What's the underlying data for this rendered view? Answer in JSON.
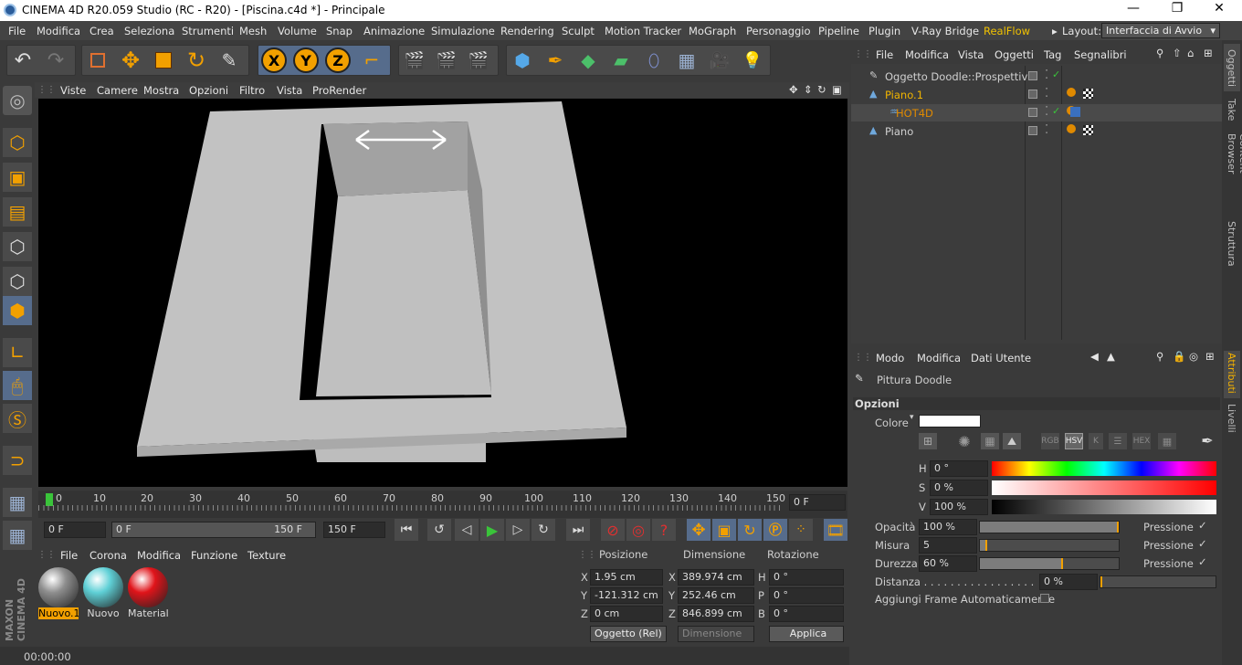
{
  "window": {
    "title": "CINEMA 4D R20.059 Studio (RC - R20) - [Piscina.c4d *] - Principale"
  },
  "menubar": {
    "items": [
      "File",
      "Modifica",
      "Crea",
      "Seleziona",
      "Strumenti",
      "Mesh",
      "Volume",
      "Snap",
      "Animazione",
      "Simulazione",
      "Rendering",
      "Sculpt",
      "Motion Tracker",
      "MoGraph",
      "Personaggio",
      "Pipeline",
      "Plugin",
      "V-Ray Bridge",
      "RealFlow"
    ],
    "layout_label": "Layout:",
    "layout_value": "Interfaccia di Avvio"
  },
  "toolbar": {
    "axis_x": "X",
    "axis_y": "Y",
    "axis_z": "Z"
  },
  "viewport": {
    "menu": [
      "Viste",
      "Camere",
      "Mostra",
      "Opzioni",
      "Filtro",
      "Vista",
      "ProRender"
    ]
  },
  "timeline": {
    "ticks": [
      "0",
      "10",
      "20",
      "30",
      "40",
      "50",
      "60",
      "70",
      "80",
      "90",
      "100",
      "110",
      "120",
      "130",
      "140",
      "150"
    ],
    "current_frame": "0 F",
    "start": "0 F",
    "range_start": "0 F",
    "range_end": "150 F",
    "end": "150 F"
  },
  "materials": {
    "menu": [
      "File",
      "Corona",
      "Modifica",
      "Funzione",
      "Texture"
    ],
    "items": [
      {
        "name": "Nuovo.1",
        "color": "#8e8e8e",
        "selected": true
      },
      {
        "name": "Nuovo",
        "color": "#5fd0d6",
        "selected": false
      },
      {
        "name": "Material",
        "color": "#e0141a",
        "selected": false
      }
    ]
  },
  "coords": {
    "headers": [
      "Posizione",
      "Dimensione",
      "Rotazione"
    ],
    "rows": [
      {
        "axis": "X",
        "pos": "1.95 cm",
        "daxis": "X",
        "dim": "389.974 cm",
        "raxis": "H",
        "rot": "0 °"
      },
      {
        "axis": "Y",
        "pos": "-121.312 cm",
        "daxis": "Y",
        "dim": "252.46 cm",
        "raxis": "P",
        "rot": "0 °"
      },
      {
        "axis": "Z",
        "pos": "0 cm",
        "daxis": "Z",
        "dim": "846.899 cm",
        "raxis": "B",
        "rot": "0 °"
      }
    ],
    "mode": "Oggetto (Rel)",
    "size_mode": "Dimensione",
    "apply": "Applica"
  },
  "status": {
    "time": "00:00:00"
  },
  "objects": {
    "menu": [
      "File",
      "Modifica",
      "Vista",
      "Oggetti",
      "Tag",
      "Segnalibri"
    ],
    "rows": [
      {
        "name": "Oggetto Doodle::Prospettiva",
        "color": "#d0d0d0",
        "indent": 0
      },
      {
        "name": "Piano.1",
        "color": "#f0b400",
        "indent": 0
      },
      {
        "name": "HOT4D",
        "color": "#e08a00",
        "indent": 1
      },
      {
        "name": "Piano",
        "color": "#d0d0d0",
        "indent": 0
      }
    ]
  },
  "right_tabs": {
    "top": [
      "Oggetti",
      "Take",
      "Content Browser",
      "Struttura"
    ],
    "bottom": [
      "Attributi",
      "Livelli"
    ]
  },
  "attributes": {
    "menu": [
      "Modo",
      "Modifica",
      "Dati Utente"
    ],
    "object_title": "Pittura Doodle",
    "section": "Opzioni",
    "color_label": "Colore",
    "color_value": "#ffffff",
    "mode_buttons": [
      "RGB",
      "HSV",
      "K",
      "HEX"
    ],
    "h_label": "H",
    "h_value": "0 °",
    "s_label": "S",
    "s_value": "0 %",
    "v_label": "V",
    "v_value": "100 %",
    "opacity_label": "Opacità",
    "opacity_value": "100 %",
    "opacity": 1.0,
    "size_label": "Misura",
    "size_value": "5",
    "size": 0.05,
    "hardness_label": "Durezza",
    "hardness_value": "60 %",
    "hardness": 0.6,
    "pressure_label": "Pressione",
    "distance_label": "Distanza . . . . . . . . . . . . . . . . .",
    "distance_value": "0 %",
    "autoframe_label": "Aggiungi Frame Automaticamente"
  }
}
